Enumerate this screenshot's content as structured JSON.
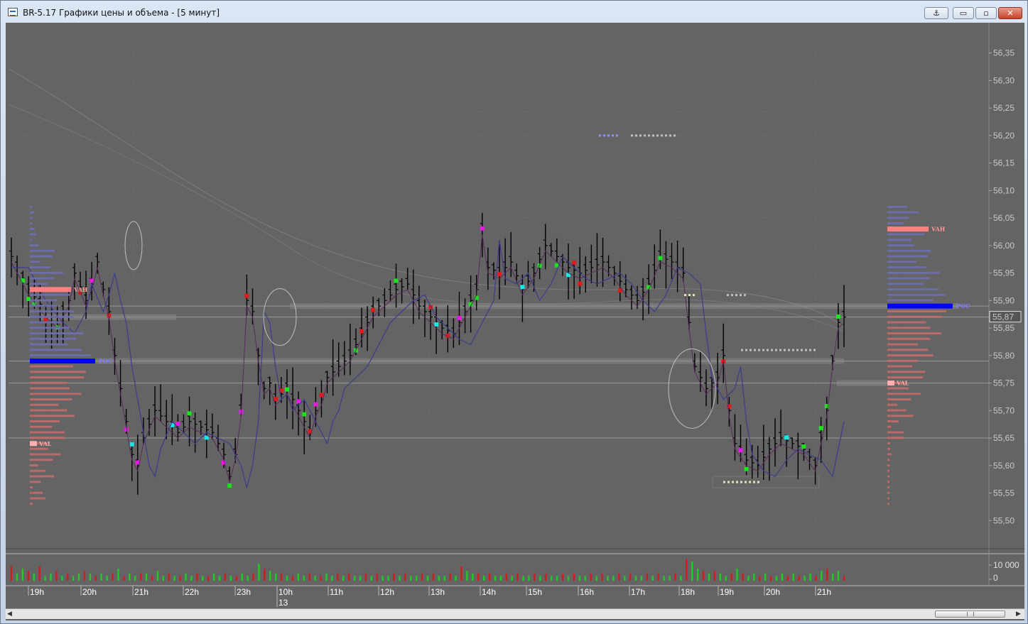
{
  "window": {
    "title": "BR-5.17 Графики цены и объема - [5 минут]",
    "buttons": {
      "anchor": "⚓",
      "minimize": "▭",
      "maximize": "▫",
      "close": "✕"
    }
  },
  "colors": {
    "background": "#646464",
    "bar": "#000000",
    "bull_marker": "#1fe01f",
    "bear_marker": "#e01b1b",
    "cyan_marker": "#19e6e6",
    "magenta_marker": "#e619e6",
    "volume_up": "#1fcc1f",
    "volume_down": "#d11c1c",
    "poc": "#0000ff",
    "vah_val": "#ff8080",
    "profile_up": "#6e6eb0",
    "profile_down": "#c46a6a"
  },
  "chart_data": [
    {
      "type": "candlestick",
      "y_axis": {
        "ylim": [
          55.45,
          56.4
        ],
        "ticks": [
          "56,35",
          "56,30",
          "56,25",
          "56,20",
          "56,15",
          "56,10",
          "56,05",
          "56,00",
          "55,95",
          "55,90",
          "55,85",
          "55,80",
          "55,75",
          "55,70",
          "55,65",
          "55,60",
          "55,55",
          "55,50"
        ],
        "position": "right"
      },
      "current_price_label": "55,87",
      "x_axis": {
        "ticks": [
          "19h",
          "20h",
          "21h",
          "22h",
          "23h",
          "10h",
          "11h",
          "12h",
          "13h",
          "14h",
          "15h",
          "16h",
          "17h",
          "18h",
          "19h",
          "20h",
          "21h"
        ],
        "date_marker": "13"
      },
      "grid": true,
      "price_path": [
        [
          0,
          55.98
        ],
        [
          3,
          55.92
        ],
        [
          6,
          55.88
        ],
        [
          8,
          55.86
        ],
        [
          10,
          55.9
        ],
        [
          11,
          55.95
        ],
        [
          13,
          55.9
        ],
        [
          14,
          55.93
        ],
        [
          15,
          55.97
        ],
        [
          16,
          55.92
        ],
        [
          17,
          55.88
        ],
        [
          18,
          55.8
        ],
        [
          19,
          55.74
        ],
        [
          20,
          55.68
        ],
        [
          21,
          55.62
        ],
        [
          22,
          55.6
        ],
        [
          23,
          55.65
        ],
        [
          25,
          55.7
        ],
        [
          27,
          55.68
        ],
        [
          29,
          55.66
        ],
        [
          31,
          55.68
        ],
        [
          33,
          55.67
        ],
        [
          35,
          55.66
        ],
        [
          37,
          55.62
        ],
        [
          38,
          55.58
        ],
        [
          39,
          55.62
        ],
        [
          40,
          55.7
        ],
        [
          41,
          55.9
        ],
        [
          42,
          55.88
        ],
        [
          43,
          55.8
        ],
        [
          44,
          55.74
        ],
        [
          45,
          55.75
        ],
        [
          46,
          55.72
        ],
        [
          48,
          55.74
        ],
        [
          50,
          55.7
        ],
        [
          51,
          55.68
        ],
        [
          52,
          55.66
        ],
        [
          53,
          55.7
        ],
        [
          54,
          55.72
        ],
        [
          55,
          55.76
        ],
        [
          57,
          55.78
        ],
        [
          59,
          55.8
        ],
        [
          61,
          55.84
        ],
        [
          63,
          55.88
        ],
        [
          65,
          55.9
        ],
        [
          67,
          55.92
        ],
        [
          69,
          55.93
        ],
        [
          71,
          55.89
        ],
        [
          73,
          55.87
        ],
        [
          75,
          55.85
        ],
        [
          77,
          55.84
        ],
        [
          79,
          55.88
        ],
        [
          81,
          55.92
        ],
        [
          82,
          56.03
        ],
        [
          83,
          55.96
        ],
        [
          85,
          55.95
        ],
        [
          87,
          55.97
        ],
        [
          89,
          55.92
        ],
        [
          91,
          55.95
        ],
        [
          93,
          56.0
        ],
        [
          95,
          55.98
        ],
        [
          97,
          55.96
        ],
        [
          99,
          55.95
        ],
        [
          101,
          55.96
        ],
        [
          103,
          55.97
        ],
        [
          105,
          55.95
        ],
        [
          107,
          55.92
        ],
        [
          109,
          55.9
        ],
        [
          111,
          55.93
        ],
        [
          113,
          55.98
        ],
        [
          115,
          55.97
        ],
        [
          117,
          55.95
        ],
        [
          118,
          55.86
        ],
        [
          119,
          55.78
        ],
        [
          121,
          55.74
        ],
        [
          123,
          55.76
        ],
        [
          124,
          55.8
        ],
        [
          125,
          55.7
        ],
        [
          126,
          55.64
        ],
        [
          128,
          55.61
        ],
        [
          130,
          55.6
        ],
        [
          132,
          55.63
        ],
        [
          134,
          55.65
        ],
        [
          136,
          55.64
        ],
        [
          138,
          55.63
        ],
        [
          140,
          55.6
        ],
        [
          142,
          55.7
        ],
        [
          143,
          55.79
        ],
        [
          144,
          55.86
        ],
        [
          145,
          55.87
        ]
      ],
      "volume_bars": [
        0.6,
        0.3,
        0.5,
        0.4,
        0.3,
        0.6,
        0.2,
        0.3,
        0.4,
        0.2,
        0.3,
        0.2,
        0.3,
        0.4,
        0.3,
        0.2,
        0.3,
        0.2,
        0.3,
        0.5,
        0.2,
        0.3,
        0.2,
        0.3,
        0.3,
        0.2,
        0.4,
        0.2,
        0.3,
        0.2,
        0.2,
        0.3,
        0.2,
        0.3,
        0.2,
        0.2,
        0.3,
        0.2,
        0.3,
        0.2,
        0.2,
        0.3,
        0.2,
        0.3,
        0.7,
        0.5,
        0.4,
        0.3,
        0.3,
        0.2,
        0.2,
        0.3,
        0.2,
        0.3,
        0.2,
        0.2,
        0.3,
        0.2,
        0.3,
        0.2,
        0.3,
        0.2,
        0.2,
        0.3,
        0.2,
        0.3,
        0.2,
        0.2,
        0.3,
        0.2,
        0.3,
        0.2,
        0.2,
        0.3,
        0.2,
        0.3,
        0.2,
        0.2,
        0.3,
        0.2,
        0.6,
        0.4,
        0.3,
        0.3,
        0.2,
        0.3,
        0.2,
        0.2,
        0.3,
        0.2,
        0.3,
        0.2,
        0.2,
        0.3,
        0.2,
        0.3,
        0.2,
        0.2,
        0.3,
        0.2,
        0.3,
        0.2,
        0.2,
        0.3,
        0.2,
        0.3,
        0.2,
        0.2,
        0.3,
        0.2,
        0.3,
        0.2,
        0.2,
        0.3,
        0.2,
        0.3,
        0.2,
        0.2,
        0.3,
        0.2,
        0.9,
        0.8,
        0.5,
        0.4,
        0.3,
        0.4,
        0.3,
        0.2,
        0.3,
        0.5,
        0.3,
        0.2,
        0.3,
        0.2,
        0.3,
        0.2,
        0.2,
        0.3,
        0.2,
        0.3,
        0.2,
        0.2,
        0.3,
        0.2,
        0.4,
        0.5,
        0.3,
        0.4,
        0.2
      ],
      "volume_axis": {
        "ticks": [
          "10 000",
          "0"
        ]
      },
      "value_area_left": {
        "vah": 55.92,
        "poc": 55.79,
        "val": 55.64
      },
      "value_area_right": {
        "vah": 56.03,
        "poc": 55.89,
        "val": 55.75
      },
      "labels": {
        "vah": "VAH",
        "poc": "POC",
        "val": "VAL"
      },
      "reference_lines": [
        55.87,
        55.79,
        55.65,
        55.89,
        55.75
      ]
    }
  ]
}
